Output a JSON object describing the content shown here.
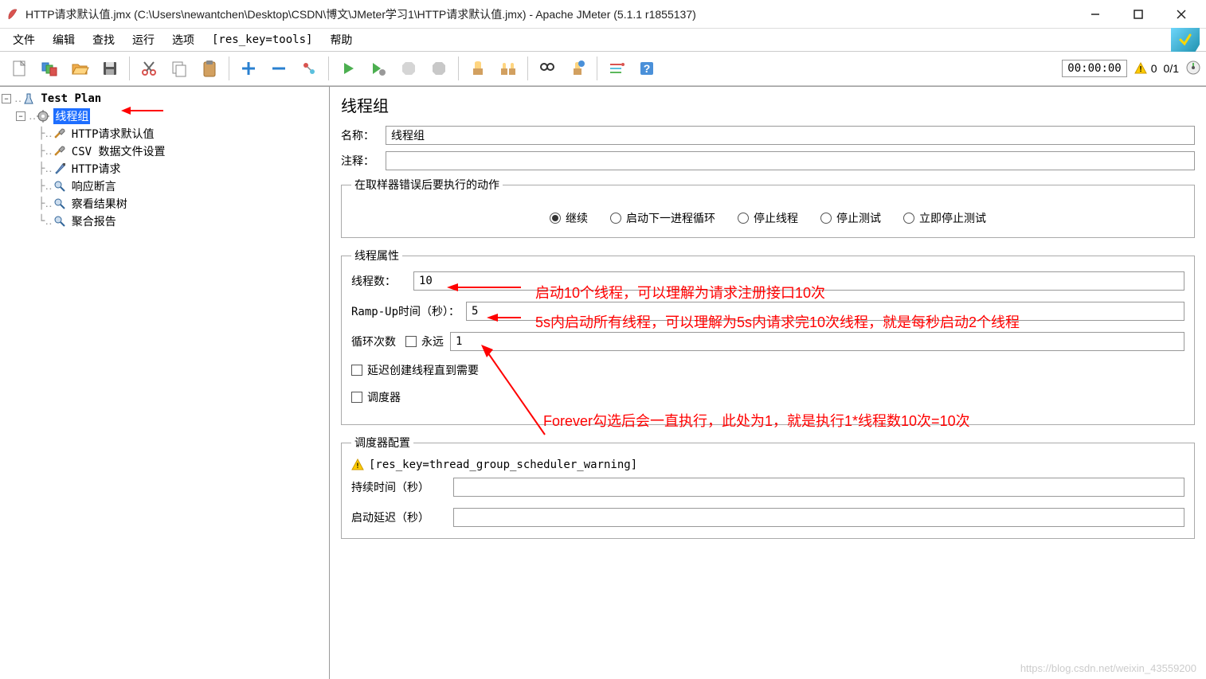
{
  "titlebar": {
    "text": "HTTP请求默认值.jmx (C:\\Users\\newantchen\\Desktop\\CSDN\\博文\\JMeter学习1\\HTTP请求默认值.jmx) - Apache JMeter (5.1.1 r1855137)"
  },
  "menu": {
    "file": "文件",
    "edit": "编辑",
    "search": "查找",
    "run": "运行",
    "options": "选项",
    "tools": "[res_key=tools]",
    "help": "帮助"
  },
  "toolbar": {
    "time": "00:00:00",
    "err_count": "0",
    "thread_count": "0/1"
  },
  "tree": {
    "root": "Test Plan",
    "thread_group": "线程组",
    "http_defaults": "HTTP请求默认值",
    "csv_config": "CSV 数据文件设置",
    "http_request": "HTTP请求",
    "response_assertion": "响应断言",
    "view_results": "察看结果树",
    "summary_report": "聚合报告"
  },
  "panel": {
    "title": "线程组",
    "name_label": "名称：",
    "name_value": "线程组",
    "comment_label": "注释：",
    "comment_value": "",
    "error_action_legend": "在取样器错误后要执行的动作",
    "radio_continue": "继续",
    "radio_next_loop": "启动下一进程循环",
    "radio_stop_thread": "停止线程",
    "radio_stop_test": "停止测试",
    "radio_stop_now": "立即停止测试",
    "props_legend": "线程属性",
    "threads_label": "线程数：",
    "threads_value": "10",
    "rampup_label": "Ramp-Up时间（秒）：",
    "rampup_value": "5",
    "loop_label": "循环次数",
    "forever_label": "永远",
    "loop_value": "1",
    "delay_create_label": "延迟创建线程直到需要",
    "scheduler_label": "调度器",
    "sched_config_legend": "调度器配置",
    "sched_warning": "[res_key=thread_group_scheduler_warning]",
    "duration_label": "持续时间（秒）",
    "duration_value": "",
    "delay_label": "启动延迟（秒）",
    "delay_value": ""
  },
  "annotations": {
    "a1": "启动10个线程，可以理解为请求注册接口10次",
    "a2": "5s内启动所有线程，可以理解为5s内请求完10次线程，就是每秒启动2个线程",
    "a3": "Forever勾选后会一直执行，此处为1，就是执行1*线程数10次=10次"
  },
  "watermark": "https://blog.csdn.net/weixin_43559200"
}
